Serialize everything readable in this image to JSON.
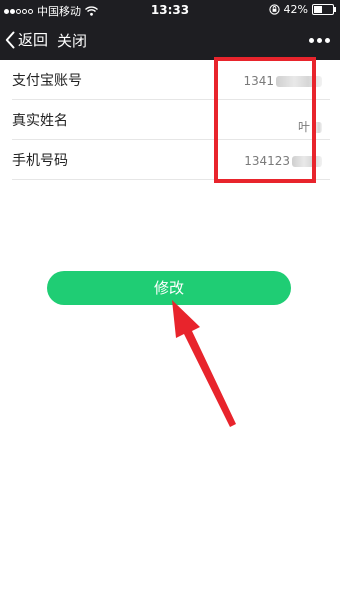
{
  "status_bar": {
    "carrier": "中国移动",
    "time": "13:33",
    "battery": "42%",
    "battery_level": 0.42
  },
  "nav": {
    "back_label": "返回",
    "close_label": "关闭"
  },
  "form": {
    "rows": [
      {
        "label": "支付宝账号",
        "value": "1341"
      },
      {
        "label": "真实姓名",
        "value": "叶"
      },
      {
        "label": "手机号码",
        "value": "134123"
      }
    ]
  },
  "modify_button": {
    "label": "修改"
  },
  "colors": {
    "accent_green": "#1fcd74",
    "annotation_red": "#e8242c",
    "header_bg": "#1e1e22"
  }
}
